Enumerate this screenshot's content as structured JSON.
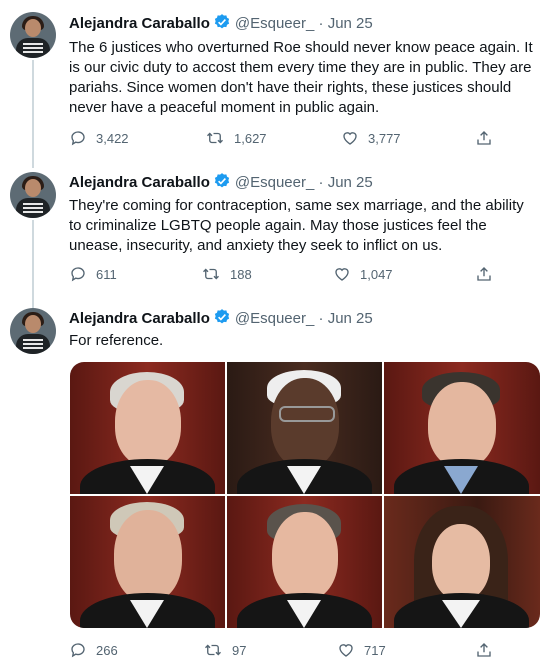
{
  "tweets": [
    {
      "author_name": "Alejandra Caraballo",
      "handle": "@Esqueer_",
      "separator": "·",
      "date": "Jun 25",
      "text": "The 6 justices who overturned Roe should never know peace again. It is our civic duty to accost them every time they are in public. They are pariahs. Since women don't have their rights, these justices should never have a peaceful moment in public again.",
      "replies": "3,422",
      "retweets": "1,627",
      "likes": "3,777"
    },
    {
      "author_name": "Alejandra Caraballo",
      "handle": "@Esqueer_",
      "separator": "·",
      "date": "Jun 25",
      "text": "They're coming for contraception, same sex marriage, and the ability to criminalize LGBTQ people again. May those justices feel the unease, insecurity, and anxiety they seek to inflict on us.",
      "replies": "611",
      "retweets": "188",
      "likes": "1,047"
    },
    {
      "author_name": "Alejandra Caraballo",
      "handle": "@Esqueer_",
      "separator": "·",
      "date": "Jun 25",
      "text": "For reference.",
      "replies": "266",
      "retweets": "97",
      "likes": "717"
    }
  ],
  "colors": {
    "text": "#0f1419",
    "muted": "#536471",
    "verified": "#1d9bf0",
    "thread_line": "#cfd9de"
  },
  "icons": [
    "verified-badge-icon",
    "reply-icon",
    "retweet-icon",
    "like-icon",
    "share-icon"
  ]
}
